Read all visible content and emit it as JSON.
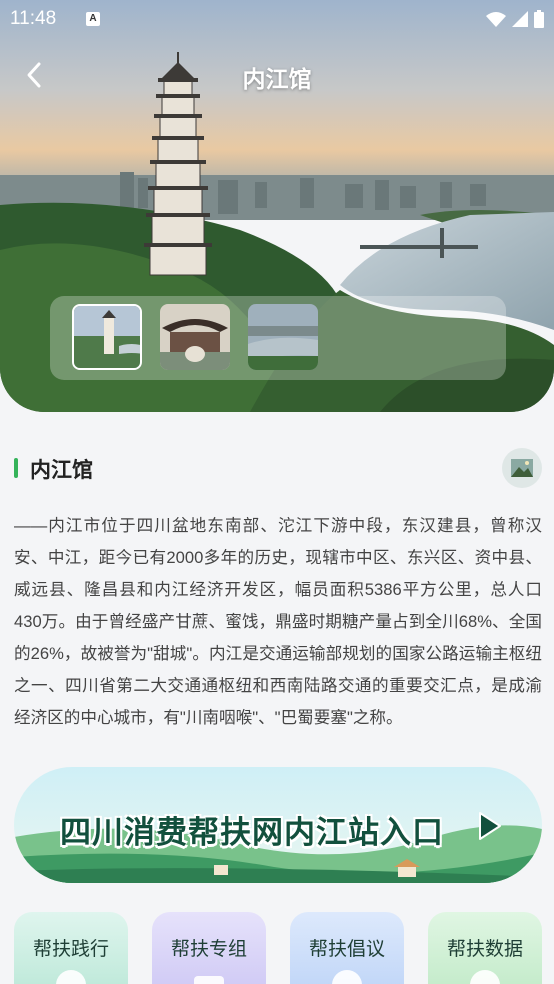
{
  "status_bar": {
    "time": "11:48",
    "sim_badge": "A",
    "icons": [
      "wifi-icon",
      "signal-icon",
      "battery-icon"
    ]
  },
  "header": {
    "title": "内江馆",
    "back_icon": "chevron-left-icon"
  },
  "gallery": {
    "thumbnails": [
      "tower-photo",
      "pavilion-photo",
      "river-city-photo"
    ],
    "selected_index": 0
  },
  "section": {
    "title": "内江馆",
    "accent_color": "#35b35a"
  },
  "description": "——内江市位于四川盆地东南部、沱江下游中段，东汉建县，曾称汉安、中江，距今已有2000多年的历史，现辖市中区、东兴区、资中县、威远县、隆昌县和内江经济开发区，幅员面积5386平方公里，总人口430万。由于曾经盛产甘蔗、蜜饯，鼎盛时期糖产量占到全川68%、全国的26%，故被誉为\"甜城\"。内江是交通运输部规划的国家公路运输主枢纽之一、四川省第二大交通通枢纽和西南陆路交通的重要交汇点，是成渝经济区的中心城市，有\"川南咽喉\"、\"巴蜀要塞\"之称。",
  "banner": {
    "text": "四川消费帮扶网内江站入口"
  },
  "cards": [
    {
      "label": "帮扶践行",
      "color": "#cfeee3"
    },
    {
      "label": "帮扶专组",
      "color": "#d9d5f7"
    },
    {
      "label": "帮扶倡议",
      "color": "#cfe0fb"
    },
    {
      "label": "帮扶数据",
      "color": "#d5f1d8"
    }
  ]
}
